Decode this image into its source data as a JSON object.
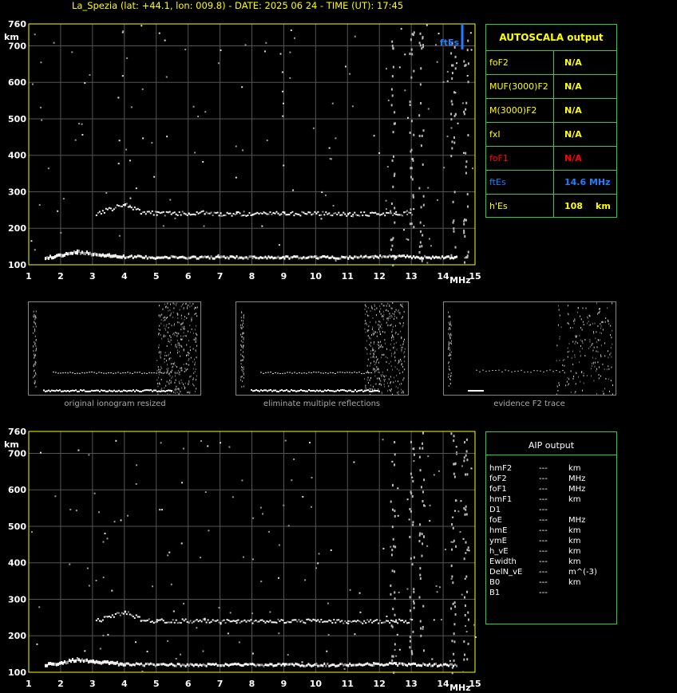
{
  "header": {
    "title": "La_Spezia (lat: +44.1, lon: 009.8) - DATE: 2025 06 24 - TIME (UT): 17:45"
  },
  "colors": {
    "grid": "#555555",
    "axis": "#ffff00",
    "panel_border": "#2ecc40",
    "es_marker": "#1e7fff",
    "trace": "#ffffff",
    "fof1_label": "#ff0000"
  },
  "chart_data": [
    {
      "type": "scatter",
      "title": "",
      "xlabel": "MHz",
      "ylabel": "km",
      "xlim": [
        1,
        15
      ],
      "ylim": [
        100,
        760
      ],
      "x_ticks": [
        "1",
        "2",
        "3",
        "4",
        "5",
        "6",
        "7",
        "8",
        "9",
        "10",
        "11",
        "12",
        "13",
        "14",
        "15"
      ],
      "y_ticks": [
        "100",
        "200",
        "300",
        "400",
        "500",
        "600",
        "700",
        "760"
      ],
      "grid": true,
      "series": [
        {
          "values": [
            [
              1.5,
              120
            ],
            [
              2.0,
              125
            ],
            [
              2.5,
              135
            ],
            [
              3.0,
              130
            ],
            [
              3.5,
              125
            ],
            [
              4.0,
              122
            ],
            [
              5.0,
              120
            ],
            [
              6.0,
              120
            ],
            [
              7.0,
              120
            ],
            [
              8.0,
              120
            ],
            [
              9.0,
              120
            ],
            [
              10.0,
              120
            ],
            [
              11.0,
              120
            ],
            [
              11.8,
              122
            ],
            [
              12.5,
              122
            ],
            [
              13.5,
              120
            ],
            [
              14.4,
              120
            ]
          ]
        },
        {
          "values": [
            [
              3.1,
              240
            ],
            [
              4.0,
              265
            ],
            [
              4.5,
              245
            ],
            [
              5.0,
              240
            ],
            [
              6.0,
              240
            ],
            [
              6.5,
              242
            ],
            [
              7.0,
              238
            ],
            [
              7.5,
              240
            ],
            [
              8.0,
              238
            ],
            [
              9.0,
              240
            ],
            [
              10.0,
              240
            ],
            [
              11.0,
              238
            ],
            [
              12.5,
              240
            ],
            [
              13.0,
              240
            ]
          ]
        }
      ],
      "annotations": [
        {
          "label": "ftEs",
          "x": 14.6
        }
      ]
    },
    {
      "type": "scatter",
      "title": "",
      "xlabel": "MHz",
      "ylabel": "km",
      "xlim": [
        1,
        15
      ],
      "ylim": [
        100,
        760
      ],
      "x_ticks": [
        "1",
        "2",
        "3",
        "4",
        "5",
        "6",
        "7",
        "8",
        "9",
        "10",
        "11",
        "12",
        "13",
        "14",
        "15"
      ],
      "y_ticks": [
        "100",
        "200",
        "300",
        "400",
        "500",
        "600",
        "700",
        "760"
      ],
      "grid": true,
      "series": [
        {
          "values": [
            [
              1.5,
              120
            ],
            [
              2.0,
              125
            ],
            [
              2.5,
              135
            ],
            [
              3.0,
              130
            ],
            [
              3.5,
              125
            ],
            [
              4.0,
              122
            ],
            [
              5.0,
              120
            ],
            [
              6.0,
              120
            ],
            [
              7.0,
              120
            ],
            [
              8.0,
              120
            ],
            [
              9.0,
              120
            ],
            [
              10.0,
              120
            ],
            [
              11.0,
              120
            ],
            [
              11.8,
              122
            ],
            [
              12.5,
              122
            ],
            [
              13.5,
              120
            ],
            [
              14.4,
              120
            ]
          ]
        },
        {
          "values": [
            [
              3.1,
              240
            ],
            [
              4.0,
              265
            ],
            [
              4.5,
              245
            ],
            [
              5.0,
              240
            ],
            [
              6.0,
              240
            ],
            [
              6.5,
              242
            ],
            [
              7.0,
              238
            ],
            [
              7.5,
              240
            ],
            [
              8.0,
              238
            ],
            [
              9.0,
              240
            ],
            [
              10.0,
              240
            ],
            [
              11.0,
              238
            ],
            [
              12.5,
              240
            ],
            [
              13.0,
              240
            ]
          ]
        }
      ]
    }
  ],
  "autoscala": {
    "title": "AUTOSCALA output",
    "rows": [
      {
        "label": "foF2",
        "value": "N/A",
        "unit": "",
        "color": "#ffff00"
      },
      {
        "label": "MUF(3000)F2",
        "value": "N/A",
        "unit": "",
        "color": "#ffff00"
      },
      {
        "label": "M(3000)F2",
        "value": "N/A",
        "unit": "",
        "color": "#ffff00"
      },
      {
        "label": "fxI",
        "value": "N/A",
        "unit": "",
        "color": "#ffff00"
      },
      {
        "label": "foF1",
        "value": "N/A",
        "unit": "",
        "color": "#ff0000"
      },
      {
        "label": "ftEs",
        "value": "14.6 MHz",
        "unit": "",
        "color": "#1e7fff"
      },
      {
        "label": "h'Es",
        "value": "108",
        "unit": "km",
        "color": "#ffff00"
      }
    ]
  },
  "aip": {
    "title": "AIP output",
    "rows": [
      {
        "label": "hmF2",
        "value": "---",
        "unit": "km"
      },
      {
        "label": "foF2",
        "value": "---",
        "unit": "MHz"
      },
      {
        "label": "foF1",
        "value": "---",
        "unit": "MHz"
      },
      {
        "label": "hmF1",
        "value": "---",
        "unit": "km"
      },
      {
        "label": "D1",
        "value": "---",
        "unit": ""
      },
      {
        "label": "foE",
        "value": "---",
        "unit": "MHz"
      },
      {
        "label": "hmE",
        "value": "---",
        "unit": "km"
      },
      {
        "label": "ymE",
        "value": "---",
        "unit": "km"
      },
      {
        "label": "h_vE",
        "value": "---",
        "unit": "km"
      },
      {
        "label": "Ewidth",
        "value": "---",
        "unit": "km"
      },
      {
        "label": "DelN_vE",
        "value": "---",
        "unit": "m^(-3)"
      },
      {
        "label": "B0",
        "value": "---",
        "unit": "km"
      },
      {
        "label": "B1",
        "value": "---",
        "unit": ""
      }
    ]
  },
  "thumbnails": [
    {
      "caption": "original ionogram resized"
    },
    {
      "caption": "eliminate multiple reflections"
    },
    {
      "caption": "evidence F2 trace"
    }
  ]
}
